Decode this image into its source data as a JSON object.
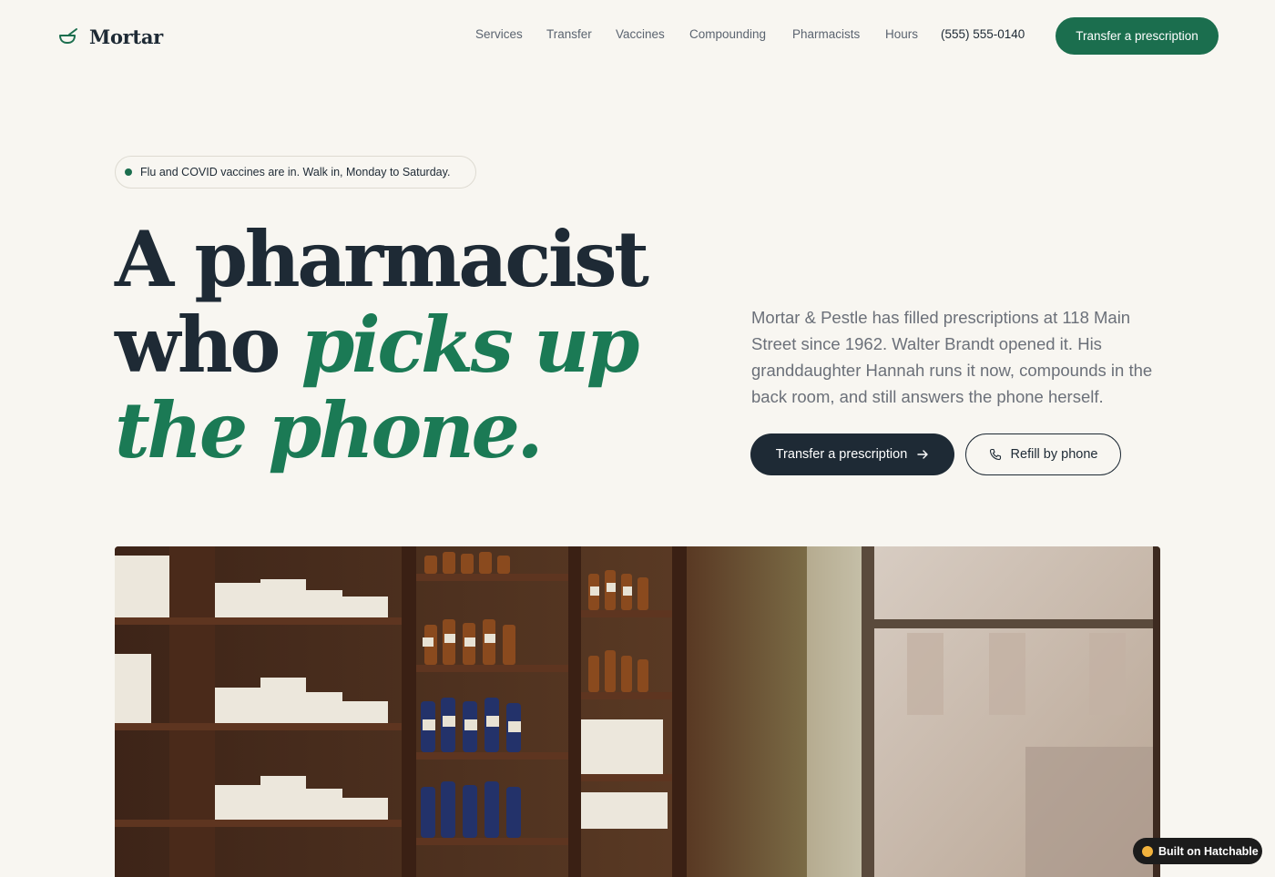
{
  "brand": {
    "name": "Mortar",
    "logo_icon": "mortar-bowl-icon",
    "accent_color": "#1b6e4e",
    "dark_color": "#1e2a35"
  },
  "nav": {
    "links": [
      "Services",
      "Transfer",
      "Vaccines",
      "Compounding",
      "Pharmacists",
      "Hours"
    ],
    "phone": "(555) 555-0140",
    "cta": "Transfer a prescription"
  },
  "announcement": {
    "text": "Flu and COVID vaccines are in. Walk in, Monday to Saturday."
  },
  "hero": {
    "headline_line1": "A pharmacist",
    "headline_word2": "who",
    "headline_accent": "picks up",
    "headline_accent2": "the phone.",
    "intro": "Mortar & Pestle has filled prescriptions at 118 Main Street since 1962. Walter Brandt opened it. His granddaughter Hannah runs it now, compounds in the back room, and still answers the phone herself.",
    "primary_cta": "Transfer a prescription",
    "primary_cta_icon": "arrow-right-icon",
    "secondary_cta": "Refill by phone",
    "secondary_cta_icon": "phone-icon"
  },
  "badge": {
    "text": "Built on Hatchable",
    "icon": "hatchable-icon"
  }
}
